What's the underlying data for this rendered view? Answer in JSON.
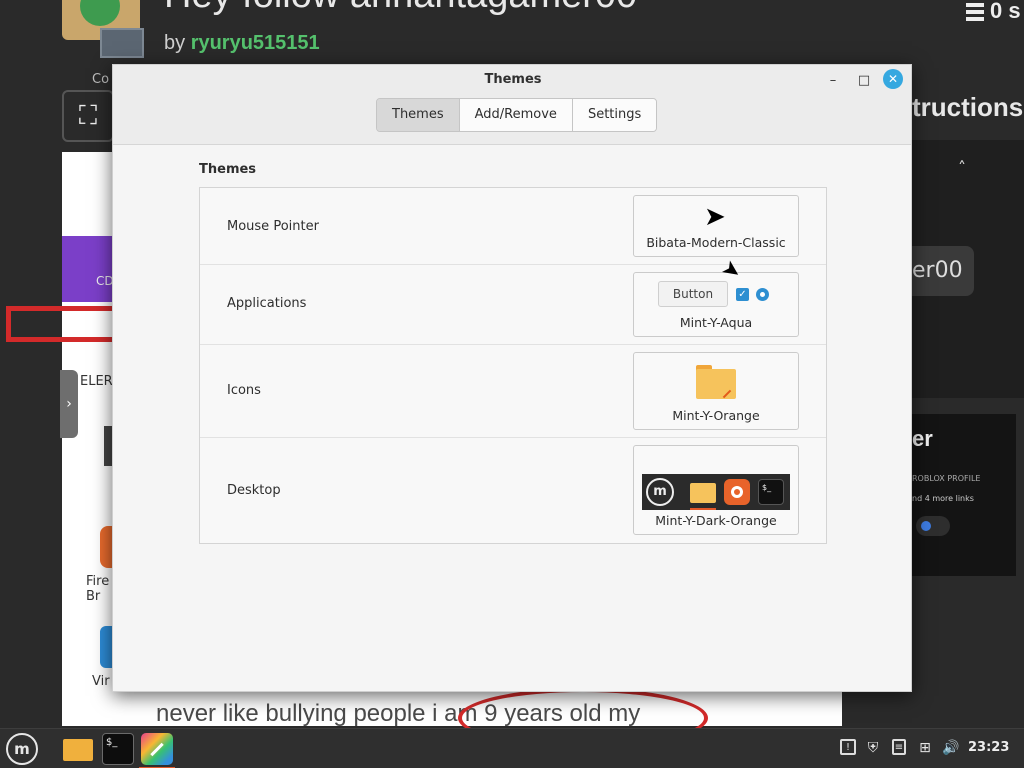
{
  "background": {
    "project_title": "Hey follow annantagamer00",
    "by_label": "by",
    "author": "ryuryu515151",
    "stats": "0 s",
    "controls_label": "Co",
    "instructions_label": "tructions",
    "user_fragment": "er00",
    "card_title": "er",
    "card_line1": "ROBLOX PROFILE",
    "card_line2": "nd 4 more links",
    "cd_label": "CD",
    "elem_label": "ELER",
    "fire_label": "Fire",
    "fire_label2": "Br",
    "vir_label": "Vir",
    "bottom_text": "never like bullying people i am 9 years old my"
  },
  "dialog": {
    "title": "Themes",
    "window_buttons": {
      "minimize": "–",
      "maximize": "□",
      "close": "✕"
    },
    "tabs": [
      {
        "label": "Themes",
        "active": true
      },
      {
        "label": "Add/Remove",
        "active": false
      },
      {
        "label": "Settings",
        "active": false
      }
    ],
    "section_title": "Themes",
    "rows": [
      {
        "label": "Mouse Pointer",
        "value": "Bibata-Modern-Classic",
        "icon": "cursor-arrow-icon"
      },
      {
        "label": "Applications",
        "value": "Mint-Y-Aqua",
        "icon": "widget-preview",
        "preview_button": "Button",
        "accent_color": "#2e8fd1"
      },
      {
        "label": "Icons",
        "value": "Mint-Y-Orange",
        "icon": "folder-icon",
        "accent_color": "#f6c35c"
      },
      {
        "label": "Desktop",
        "value": "Mint-Y-Dark-Orange",
        "icon": "panel-preview",
        "accent_color": "#e0582a"
      }
    ]
  },
  "taskbar": {
    "menu_icon": "mint-menu-icon",
    "apps": [
      "files-icon",
      "terminal-icon",
      "themes-icon"
    ],
    "tray": [
      "update-manager-icon",
      "shield-icon",
      "clipboard-icon",
      "network-icon",
      "volume-icon"
    ],
    "clock": "23:23"
  }
}
